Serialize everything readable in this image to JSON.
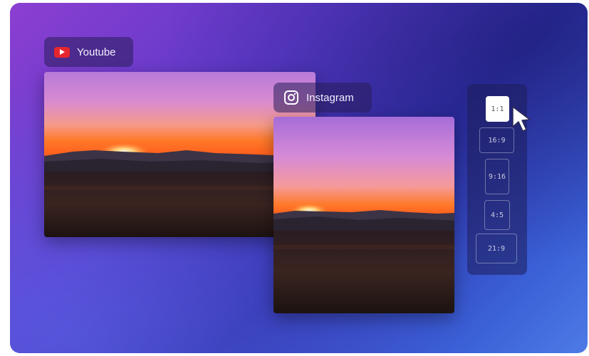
{
  "tags": {
    "youtube": {
      "label": "Youtube",
      "icon": "youtube-icon",
      "color": "#e6262e"
    },
    "instagram": {
      "label": "Instagram",
      "icon": "instagram-icon"
    }
  },
  "aspect_ratios": {
    "options": [
      "1:1",
      "16:9",
      "9:16",
      "4:5",
      "21:9"
    ],
    "selected": "1:1"
  },
  "colors": {
    "background_start": "#8c3fd1",
    "background_end": "#4d7be6",
    "sunset_orange": "#ff7a2a"
  }
}
